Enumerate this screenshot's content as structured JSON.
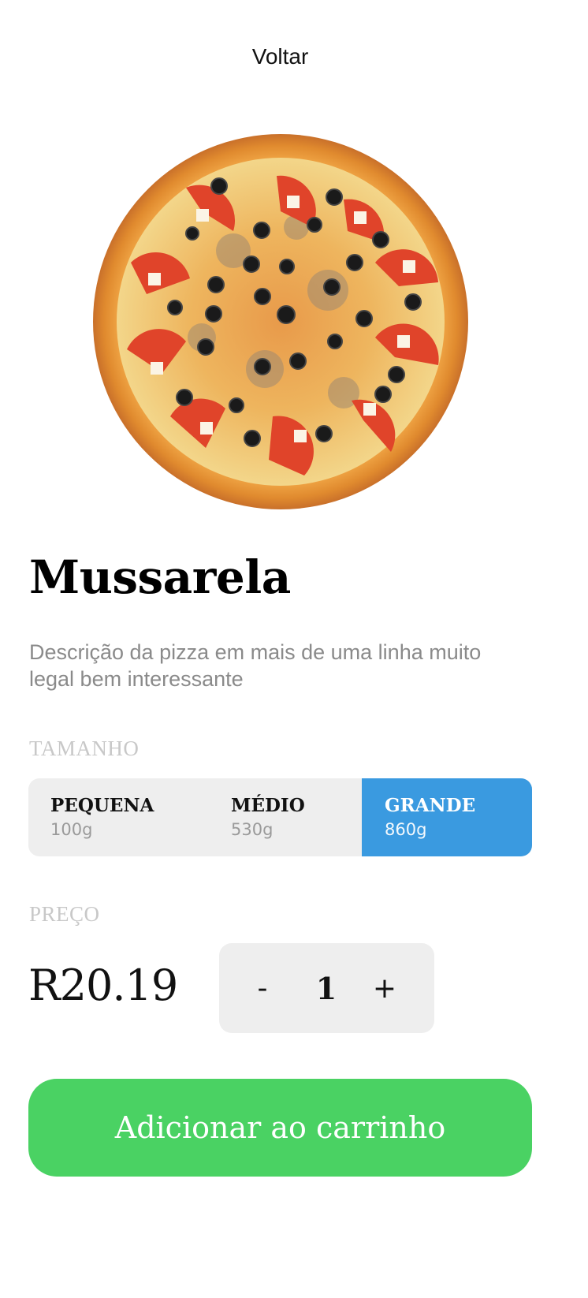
{
  "nav": {
    "back_label": "Voltar"
  },
  "product": {
    "image_alt": "pizza-image",
    "name": "Mussarela",
    "description": "Descrição da pizza em mais de uma linha muito legal bem interessante"
  },
  "size": {
    "label": "TAMANHO",
    "options": [
      {
        "name": "PEQUENA",
        "weight": "100g",
        "selected": false
      },
      {
        "name": "MÉDIO",
        "weight": "530g",
        "selected": false
      },
      {
        "name": "GRANDE",
        "weight": "860g",
        "selected": true
      }
    ]
  },
  "price": {
    "label": "PREÇO",
    "value": "R20.19"
  },
  "quantity": {
    "minus": "-",
    "value": "1",
    "plus": "+"
  },
  "cart": {
    "add_label": "Adicionar ao carrinho"
  },
  "colors": {
    "selected_size": "#3a9ae0",
    "add_button": "#4ad263",
    "neutral_panel": "#eeeeee"
  }
}
